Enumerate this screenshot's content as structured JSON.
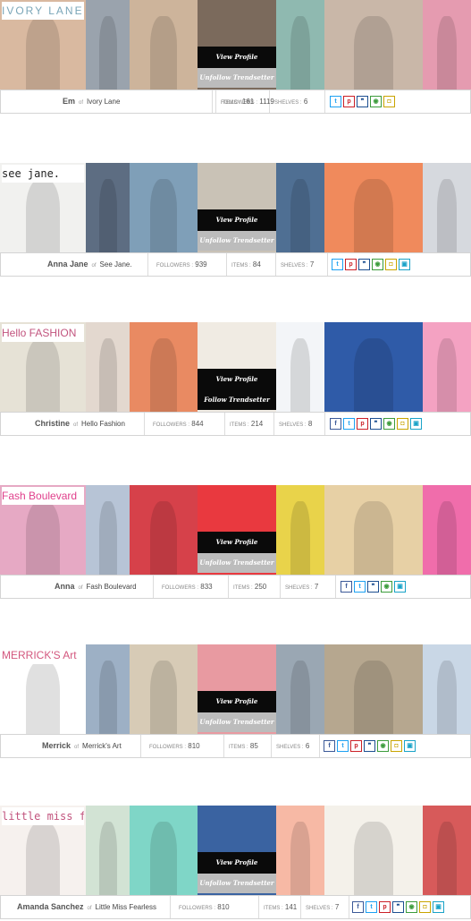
{
  "button_labels": {
    "view_profile": "View Profile",
    "unfollow": "Unfollow Trendsetter",
    "follow": "Follow Trendsetter"
  },
  "stat_labels": {
    "of": "of",
    "followers": "FOLLOWERS :",
    "items": "ITEMS :",
    "shelves": "SHELVES :"
  },
  "icon_defs": {
    "twitter": {
      "glyph": "t",
      "color": "#1da1f2"
    },
    "pinterest": {
      "glyph": "p",
      "color": "#cb2027"
    },
    "blog": {
      "glyph": "❞",
      "color": "#1d4f91"
    },
    "facebook": {
      "glyph": "f",
      "color": "#3b5998"
    },
    "polyvore": {
      "glyph": "◉",
      "color": "#3c9c3c"
    },
    "shop": {
      "glyph": "◘",
      "color": "#c9a400"
    },
    "tumblr": {
      "glyph": "▣",
      "color": "#1aa3c8"
    }
  },
  "trendsetters": [
    {
      "name": "Em",
      "shop": "Ivory Lane",
      "followers": "1119",
      "items": "161",
      "shelves": "6",
      "follow_label": "Unfollow Trendsetter",
      "logo_text": "IVORY LANE",
      "logo_color": "#7aa6b8",
      "icons": [
        "twitter",
        "pinterest",
        "blog",
        "polyvore",
        "shop"
      ]
    },
    {
      "name": "Anna Jane",
      "shop": "See Jane.",
      "followers": "939",
      "items": "84",
      "shelves": "7",
      "follow_label": "Unfollow Trendsetter",
      "logo_text": "see jane.",
      "logo_color": "#222222",
      "icons": [
        "twitter",
        "pinterest",
        "blog",
        "polyvore",
        "shop",
        "tumblr"
      ]
    },
    {
      "name": "Christine",
      "shop": "Hello Fashion",
      "followers": "844",
      "items": "214",
      "shelves": "8",
      "follow_label": "Follow Trendsetter",
      "logo_text": "Hello FASHION",
      "logo_color": "#c2547e",
      "icons": [
        "facebook",
        "twitter",
        "pinterest",
        "blog",
        "polyvore",
        "shop",
        "tumblr"
      ]
    },
    {
      "name": "Anna",
      "shop": "Fash Boulevard",
      "followers": "833",
      "items": "250",
      "shelves": "7",
      "follow_label": "Unfollow Trendsetter",
      "logo_text": "Fash Boulevard",
      "logo_color": "#e0408c",
      "icons": [
        "facebook",
        "twitter",
        "blog",
        "polyvore",
        "tumblr"
      ]
    },
    {
      "name": "Merrick",
      "shop": "Merrick's Art",
      "followers": "810",
      "items": "85",
      "shelves": "6",
      "follow_label": "Unfollow Trendsetter",
      "logo_text": "MERRICK'S Art",
      "logo_color": "#ffffff",
      "icons": [
        "facebook",
        "twitter",
        "pinterest",
        "blog",
        "polyvore",
        "shop",
        "tumblr"
      ]
    },
    {
      "name": "Amanda Sanchez",
      "shop": "Little Miss Fearless",
      "followers": "810",
      "items": "141",
      "shelves": "7",
      "follow_label": "Unfollow Trendsetter",
      "logo_text": "little miss fearless",
      "logo_color": "#c2547e",
      "icons": [
        "facebook",
        "twitter",
        "pinterest",
        "blog",
        "polyvore",
        "shop",
        "tumblr"
      ]
    }
  ]
}
